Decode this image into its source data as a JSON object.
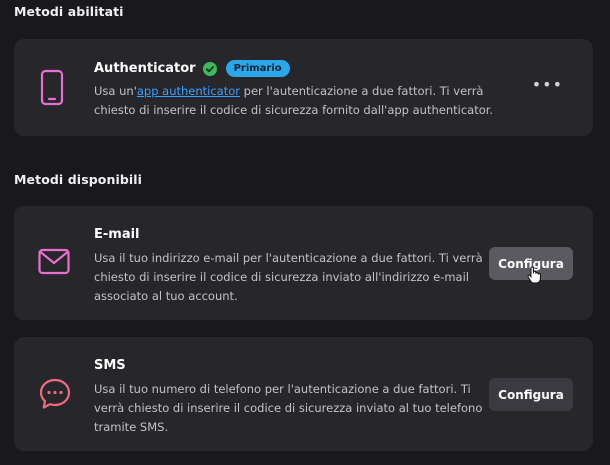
{
  "enabled": {
    "section_title": "Metodi abilitati",
    "authenticator": {
      "title": "Authenticator",
      "badge": "Primario",
      "desc_prefix": "Usa un'",
      "desc_link": "app authenticator",
      "desc_suffix": " per l'autenticazione a due fattori. Ti verrà chiesto di inserire il codice di sicurezza fornito dall'app authenticator.",
      "menu_label": "•••",
      "icon": "smartphone-icon"
    }
  },
  "available": {
    "section_title": "Metodi disponibili",
    "email": {
      "title": "E-mail",
      "desc": "Usa il tuo indirizzo e-mail per l'autenticazione a due fattori. Ti verrà chiesto di inserire il codice di sicurezza inviato all'indirizzo e-mail associato al tuo account.",
      "button": "Configura",
      "icon": "envelope-icon"
    },
    "sms": {
      "title": "SMS",
      "desc": "Usa il tuo numero di telefono per l'autenticazione a due fattori. Ti verrà chiesto di inserire il codice di sicurezza inviato al tuo telefono tramite SMS.",
      "button": "Configura",
      "icon": "chat-bubble-icon"
    }
  },
  "colors": {
    "background": "#19191c",
    "card": "#26262b",
    "accent_icon": "#e86fd0",
    "sms_icon": "#f06b7e",
    "link": "#3aa0ff",
    "badge": "#2aa7e8",
    "verified": "#3dbb5a"
  }
}
